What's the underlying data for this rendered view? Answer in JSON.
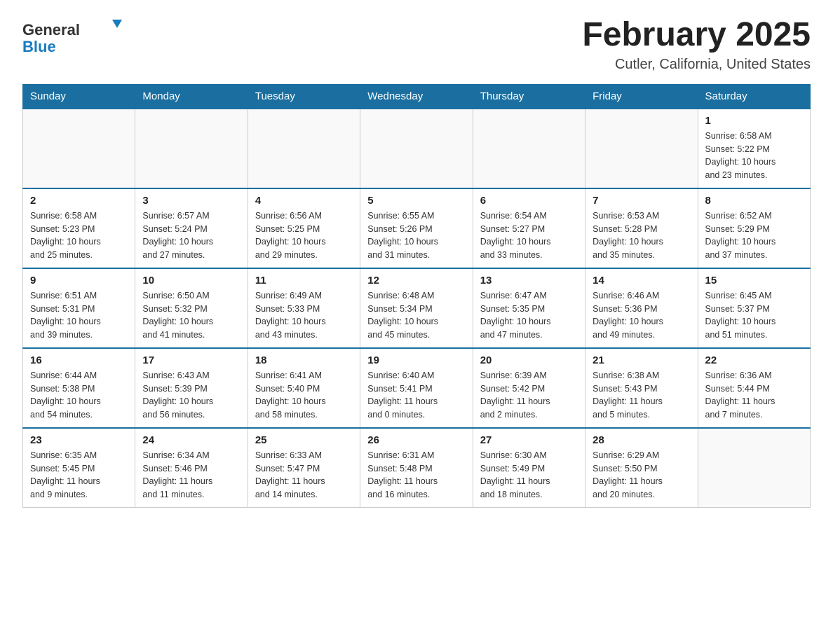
{
  "header": {
    "logo_general": "General",
    "logo_blue": "Blue",
    "month_title": "February 2025",
    "location": "Cutler, California, United States"
  },
  "days_of_week": [
    "Sunday",
    "Monday",
    "Tuesday",
    "Wednesday",
    "Thursday",
    "Friday",
    "Saturday"
  ],
  "weeks": [
    [
      {
        "day": "",
        "info": ""
      },
      {
        "day": "",
        "info": ""
      },
      {
        "day": "",
        "info": ""
      },
      {
        "day": "",
        "info": ""
      },
      {
        "day": "",
        "info": ""
      },
      {
        "day": "",
        "info": ""
      },
      {
        "day": "1",
        "info": "Sunrise: 6:58 AM\nSunset: 5:22 PM\nDaylight: 10 hours\nand 23 minutes."
      }
    ],
    [
      {
        "day": "2",
        "info": "Sunrise: 6:58 AM\nSunset: 5:23 PM\nDaylight: 10 hours\nand 25 minutes."
      },
      {
        "day": "3",
        "info": "Sunrise: 6:57 AM\nSunset: 5:24 PM\nDaylight: 10 hours\nand 27 minutes."
      },
      {
        "day": "4",
        "info": "Sunrise: 6:56 AM\nSunset: 5:25 PM\nDaylight: 10 hours\nand 29 minutes."
      },
      {
        "day": "5",
        "info": "Sunrise: 6:55 AM\nSunset: 5:26 PM\nDaylight: 10 hours\nand 31 minutes."
      },
      {
        "day": "6",
        "info": "Sunrise: 6:54 AM\nSunset: 5:27 PM\nDaylight: 10 hours\nand 33 minutes."
      },
      {
        "day": "7",
        "info": "Sunrise: 6:53 AM\nSunset: 5:28 PM\nDaylight: 10 hours\nand 35 minutes."
      },
      {
        "day": "8",
        "info": "Sunrise: 6:52 AM\nSunset: 5:29 PM\nDaylight: 10 hours\nand 37 minutes."
      }
    ],
    [
      {
        "day": "9",
        "info": "Sunrise: 6:51 AM\nSunset: 5:31 PM\nDaylight: 10 hours\nand 39 minutes."
      },
      {
        "day": "10",
        "info": "Sunrise: 6:50 AM\nSunset: 5:32 PM\nDaylight: 10 hours\nand 41 minutes."
      },
      {
        "day": "11",
        "info": "Sunrise: 6:49 AM\nSunset: 5:33 PM\nDaylight: 10 hours\nand 43 minutes."
      },
      {
        "day": "12",
        "info": "Sunrise: 6:48 AM\nSunset: 5:34 PM\nDaylight: 10 hours\nand 45 minutes."
      },
      {
        "day": "13",
        "info": "Sunrise: 6:47 AM\nSunset: 5:35 PM\nDaylight: 10 hours\nand 47 minutes."
      },
      {
        "day": "14",
        "info": "Sunrise: 6:46 AM\nSunset: 5:36 PM\nDaylight: 10 hours\nand 49 minutes."
      },
      {
        "day": "15",
        "info": "Sunrise: 6:45 AM\nSunset: 5:37 PM\nDaylight: 10 hours\nand 51 minutes."
      }
    ],
    [
      {
        "day": "16",
        "info": "Sunrise: 6:44 AM\nSunset: 5:38 PM\nDaylight: 10 hours\nand 54 minutes."
      },
      {
        "day": "17",
        "info": "Sunrise: 6:43 AM\nSunset: 5:39 PM\nDaylight: 10 hours\nand 56 minutes."
      },
      {
        "day": "18",
        "info": "Sunrise: 6:41 AM\nSunset: 5:40 PM\nDaylight: 10 hours\nand 58 minutes."
      },
      {
        "day": "19",
        "info": "Sunrise: 6:40 AM\nSunset: 5:41 PM\nDaylight: 11 hours\nand 0 minutes."
      },
      {
        "day": "20",
        "info": "Sunrise: 6:39 AM\nSunset: 5:42 PM\nDaylight: 11 hours\nand 2 minutes."
      },
      {
        "day": "21",
        "info": "Sunrise: 6:38 AM\nSunset: 5:43 PM\nDaylight: 11 hours\nand 5 minutes."
      },
      {
        "day": "22",
        "info": "Sunrise: 6:36 AM\nSunset: 5:44 PM\nDaylight: 11 hours\nand 7 minutes."
      }
    ],
    [
      {
        "day": "23",
        "info": "Sunrise: 6:35 AM\nSunset: 5:45 PM\nDaylight: 11 hours\nand 9 minutes."
      },
      {
        "day": "24",
        "info": "Sunrise: 6:34 AM\nSunset: 5:46 PM\nDaylight: 11 hours\nand 11 minutes."
      },
      {
        "day": "25",
        "info": "Sunrise: 6:33 AM\nSunset: 5:47 PM\nDaylight: 11 hours\nand 14 minutes."
      },
      {
        "day": "26",
        "info": "Sunrise: 6:31 AM\nSunset: 5:48 PM\nDaylight: 11 hours\nand 16 minutes."
      },
      {
        "day": "27",
        "info": "Sunrise: 6:30 AM\nSunset: 5:49 PM\nDaylight: 11 hours\nand 18 minutes."
      },
      {
        "day": "28",
        "info": "Sunrise: 6:29 AM\nSunset: 5:50 PM\nDaylight: 11 hours\nand 20 minutes."
      },
      {
        "day": "",
        "info": ""
      }
    ]
  ]
}
